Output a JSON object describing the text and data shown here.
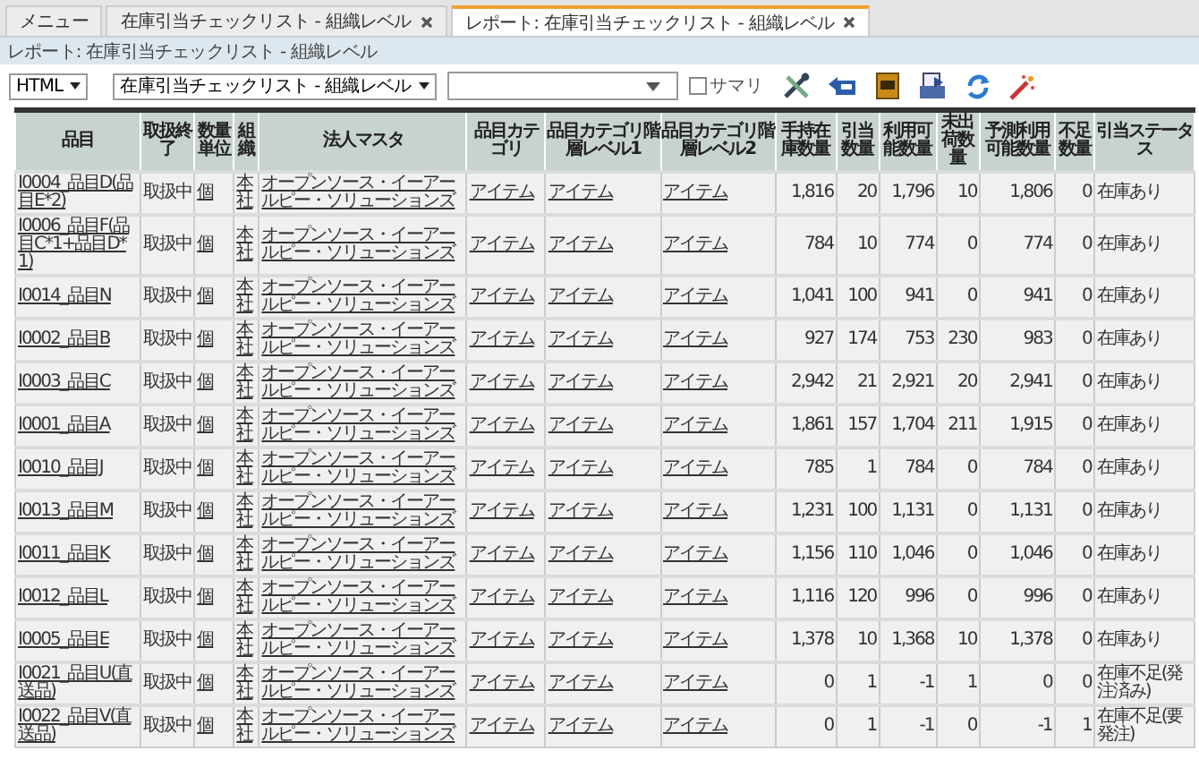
{
  "tabs": [
    {
      "label": "メニュー",
      "closable": false,
      "selected": false
    },
    {
      "label": "在庫引当チェックリスト - 組織レベル",
      "closable": true,
      "selected": false
    },
    {
      "label": "レポート: 在庫引当チェックリスト - 組織レベル",
      "closable": true,
      "selected": true
    }
  ],
  "breadcrumb": "レポート: 在庫引当チェックリスト - 組織レベル",
  "toolbar": {
    "format": "HTML",
    "report": "在庫引当チェックリスト - 組織レベル",
    "summary": {
      "label": "サマリ",
      "checked": false
    }
  },
  "table": {
    "columns": [
      {
        "label": "品目",
        "kind": "link"
      },
      {
        "label": "取扱終了",
        "kind": "text"
      },
      {
        "label": "数量単位",
        "kind": "link"
      },
      {
        "label": "組織",
        "kind": "link"
      },
      {
        "label": "法人マスタ",
        "kind": "link"
      },
      {
        "label": "品目カテゴリ",
        "kind": "link"
      },
      {
        "label": "品目カテゴリ階層レベル1",
        "kind": "link"
      },
      {
        "label": "品目カテゴリ階層レベル2",
        "kind": "link"
      },
      {
        "label": "手持在庫数量",
        "kind": "number"
      },
      {
        "label": "引当数量",
        "kind": "number"
      },
      {
        "label": "利用可能数量",
        "kind": "number"
      },
      {
        "label": "未出荷数量",
        "kind": "number"
      },
      {
        "label": "予測利用可能数量",
        "kind": "number"
      },
      {
        "label": "不足数量",
        "kind": "number"
      },
      {
        "label": "引当ステータス",
        "kind": "text"
      }
    ],
    "rows": [
      [
        "I0004_品目D(品目E*2)",
        "取扱中",
        "個",
        "本社",
        "オープンソース・イーアールピー・ソリューションズ",
        "アイテム",
        "アイテム",
        "アイテム",
        "1,816",
        "20",
        "1,796",
        "10",
        "1,806",
        "0",
        "在庫あり"
      ],
      [
        "I0006_品目F(品目C*1+品目D*1)",
        "取扱中",
        "個",
        "本社",
        "オープンソース・イーアールピー・ソリューションズ",
        "アイテム",
        "アイテム",
        "アイテム",
        "784",
        "10",
        "774",
        "0",
        "774",
        "0",
        "在庫あり"
      ],
      [
        "I0014_品目N",
        "取扱中",
        "個",
        "本社",
        "オープンソース・イーアールピー・ソリューションズ",
        "アイテム",
        "アイテム",
        "アイテム",
        "1,041",
        "100",
        "941",
        "0",
        "941",
        "0",
        "在庫あり"
      ],
      [
        "I0002_品目B",
        "取扱中",
        "個",
        "本社",
        "オープンソース・イーアールピー・ソリューションズ",
        "アイテム",
        "アイテム",
        "アイテム",
        "927",
        "174",
        "753",
        "230",
        "983",
        "0",
        "在庫あり"
      ],
      [
        "I0003_品目C",
        "取扱中",
        "個",
        "本社",
        "オープンソース・イーアールピー・ソリューションズ",
        "アイテム",
        "アイテム",
        "アイテム",
        "2,942",
        "21",
        "2,921",
        "20",
        "2,941",
        "0",
        "在庫あり"
      ],
      [
        "I0001_品目A",
        "取扱中",
        "個",
        "本社",
        "オープンソース・イーアールピー・ソリューションズ",
        "アイテム",
        "アイテム",
        "アイテム",
        "1,861",
        "157",
        "1,704",
        "211",
        "1,915",
        "0",
        "在庫あり"
      ],
      [
        "I0010_品目J",
        "取扱中",
        "個",
        "本社",
        "オープンソース・イーアールピー・ソリューションズ",
        "アイテム",
        "アイテム",
        "アイテム",
        "785",
        "1",
        "784",
        "0",
        "784",
        "0",
        "在庫あり"
      ],
      [
        "I0013_品目M",
        "取扱中",
        "個",
        "本社",
        "オープンソース・イーアールピー・ソリューションズ",
        "アイテム",
        "アイテム",
        "アイテム",
        "1,231",
        "100",
        "1,131",
        "0",
        "1,131",
        "0",
        "在庫あり"
      ],
      [
        "I0011_品目K",
        "取扱中",
        "個",
        "本社",
        "オープンソース・イーアールピー・ソリューションズ",
        "アイテム",
        "アイテム",
        "アイテム",
        "1,156",
        "110",
        "1,046",
        "0",
        "1,046",
        "0",
        "在庫あり"
      ],
      [
        "I0012_品目L",
        "取扱中",
        "個",
        "本社",
        "オープンソース・イーアールピー・ソリューションズ",
        "アイテム",
        "アイテム",
        "アイテム",
        "1,116",
        "120",
        "996",
        "0",
        "996",
        "0",
        "在庫あり"
      ],
      [
        "I0005_品目E",
        "取扱中",
        "個",
        "本社",
        "オープンソース・イーアールピー・ソリューションズ",
        "アイテム",
        "アイテム",
        "アイテム",
        "1,378",
        "10",
        "1,368",
        "10",
        "1,378",
        "0",
        "在庫あり"
      ],
      [
        "I0021_品目U(直送品)",
        "取扱中",
        "個",
        "本社",
        "オープンソース・イーアールピー・ソリューションズ",
        "アイテム",
        "アイテム",
        "アイテム",
        "0",
        "1",
        "-1",
        "1",
        "0",
        "0",
        "在庫不足(発注済み)"
      ],
      [
        "I0022_品目V(直送品)",
        "取扱中",
        "個",
        "本社",
        "オープンソース・イーアールピー・ソリューションズ",
        "アイテム",
        "アイテム",
        "アイテム",
        "0",
        "1",
        "-1",
        "0",
        "-1",
        "1",
        "在庫不足(要発注)"
      ]
    ]
  }
}
